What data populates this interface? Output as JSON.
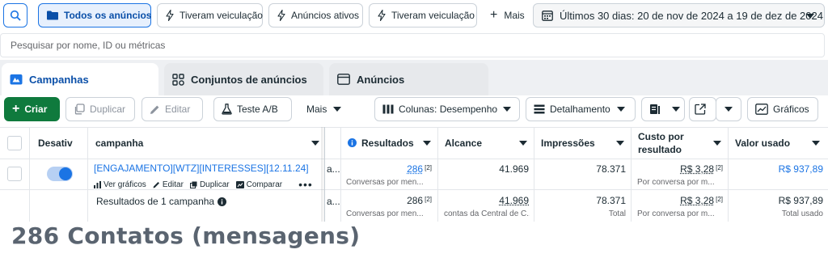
{
  "filters": {
    "active": "Todos os anúncios",
    "items": [
      "Tiveram veiculação",
      "Anúncios ativos",
      "Tiveram veiculação"
    ],
    "more": "Mais",
    "date_range": "Últimos 30 dias: 20 de nov de 2024 a 19 de dez de 2024"
  },
  "search": {
    "placeholder": "Pesquisar por nome, ID ou métricas"
  },
  "tabs": [
    {
      "label": "Campanhas"
    },
    {
      "label": "Conjuntos de anúncios"
    },
    {
      "label": "Anúncios"
    }
  ],
  "toolbar": {
    "create": "Criar",
    "duplicate": "Duplicar",
    "edit": "Editar",
    "ab_test": "Teste A/B",
    "more": "Mais",
    "columns": "Colunas: Desempenho",
    "breakdown": "Detalhamento",
    "charts": "Gráficos"
  },
  "table": {
    "headers": {
      "status": "Desativ",
      "name": "campanha",
      "results": "Resultados",
      "reach": "Alcance",
      "impressions": "Impressões",
      "cpr_line1": "Custo por",
      "cpr_line2": "resultado",
      "spent": "Valor usado"
    },
    "campaign": {
      "name": "[ENGAJAMENTO][WTZ][INTERESSES][12.11.24]",
      "cut_cell": "a...",
      "results": "286",
      "results_fn": "[2]",
      "results_sub": "Conversas por men...",
      "reach": "41.969",
      "impressions": "78.371",
      "cpr": "R$ 3,28",
      "cpr_fn": "[2]",
      "cpr_sub": "Por conversa por m...",
      "spent": "R$ 937,89",
      "actions": {
        "charts": "Ver gráficos",
        "edit": "Editar",
        "duplicate": "Duplicar",
        "compare": "Comparar",
        "more": "•••"
      }
    },
    "summary": {
      "label": "Resultados de 1 campanha",
      "cut_cell": "a...",
      "results": "286",
      "results_fn": "[2]",
      "results_sub": "Conversas por men...",
      "reach": "41.969",
      "reach_sub": "contas da Central de C...",
      "impressions": "78.371",
      "impressions_sub": "Total",
      "cpr": "R$ 3,28",
      "cpr_fn": "[2]",
      "cpr_sub": "Por conversa por m...",
      "spent": "R$ 937,89",
      "spent_sub": "Total usado"
    }
  },
  "caption": "286 Contatos (mensagens)",
  "colors": {
    "accent": "#1b74e4",
    "create": "#0f7a3d",
    "caption": "#5a6470"
  }
}
